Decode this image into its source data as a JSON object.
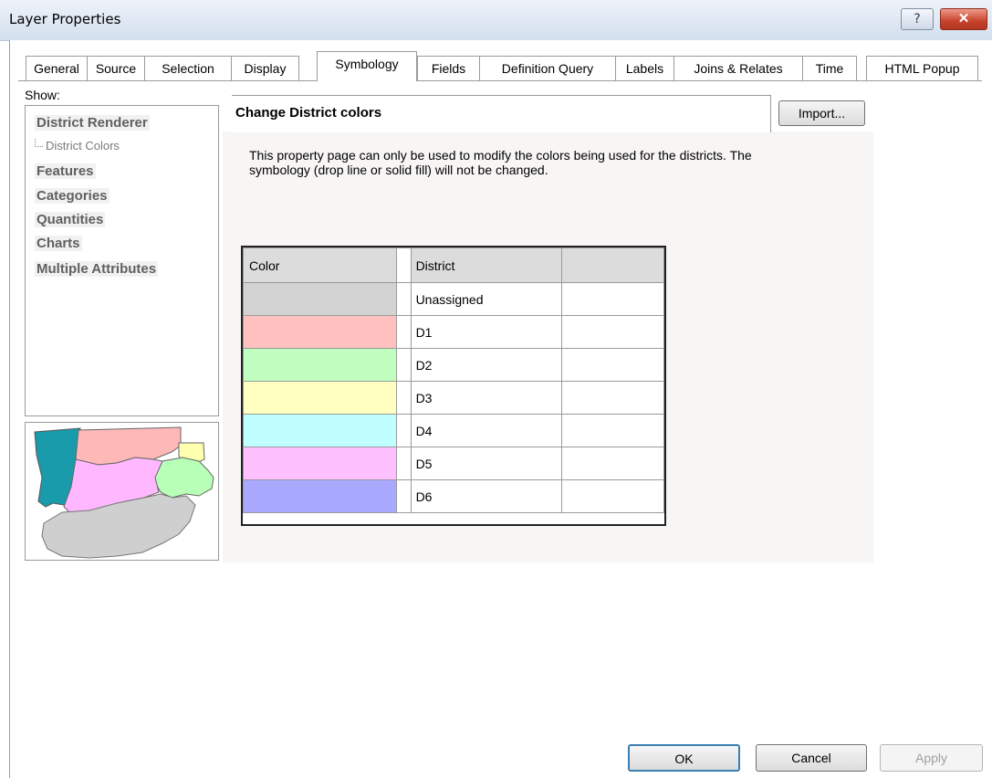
{
  "window": {
    "title": "Layer Properties",
    "help_glyph": "?",
    "close_glyph": "✕"
  },
  "tabs": [
    {
      "label": "General"
    },
    {
      "label": "Source"
    },
    {
      "label": "Selection"
    },
    {
      "label": "Display"
    },
    {
      "label": "Symbology",
      "active": true
    },
    {
      "label": "Fields"
    },
    {
      "label": "Definition Query"
    },
    {
      "label": "Labels"
    },
    {
      "label": "Joins & Relates"
    },
    {
      "label": "Time"
    },
    {
      "label": "HTML Popup"
    }
  ],
  "left": {
    "show_label": "Show:",
    "tree": {
      "district_renderer": "District Renderer",
      "district_colors": "District Colors",
      "features": "Features",
      "categories": "Categories",
      "quantities": "Quantities",
      "charts": "Charts",
      "multiple_attributes": "Multiple Attributes"
    }
  },
  "main": {
    "header_title": "Change District colors",
    "import_label": "Import...",
    "description": "This property page can only be used to modify the colors being used for the districts.  The symbology (drop line or solid fill) will not be changed.",
    "table": {
      "col_color": "Color",
      "col_district": "District",
      "rows": [
        {
          "district": "Unassigned",
          "color": "#d3d3d3"
        },
        {
          "district": "D1",
          "color": "#ffc0c0"
        },
        {
          "district": "D2",
          "color": "#c0ffc0"
        },
        {
          "district": "D3",
          "color": "#ffffc0"
        },
        {
          "district": "D4",
          "color": "#c0ffff"
        },
        {
          "district": "D5",
          "color": "#ffc0ff"
        },
        {
          "district": "D6",
          "color": "#a8a8ff"
        }
      ]
    }
  },
  "buttons": {
    "ok": "OK",
    "cancel": "Cancel",
    "apply": "Apply"
  }
}
